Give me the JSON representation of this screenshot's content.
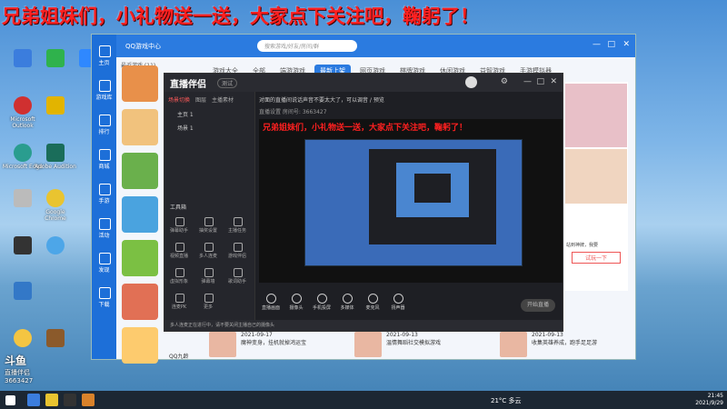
{
  "overlay_text": "兄弟姐妹们，小礼物送一送，大家点下关注吧，鞠躬了！",
  "desktop": {
    "icons": [
      {
        "label": "",
        "color": "#3b7ddd"
      },
      {
        "label": "",
        "color": "#2fb24c"
      },
      {
        "label": "",
        "color": "#2f88ff"
      },
      {
        "label": "",
        "color": "#e2b400"
      },
      {
        "label": "Microsoft Outlook",
        "color": "#d03030"
      },
      {
        "label": "",
        "color": "#f4c542"
      },
      {
        "label": "Microsoft Edge",
        "color": "#2a9d8f"
      },
      {
        "label": "Adobe Audition",
        "color": "#1a6d5a"
      },
      {
        "label": "",
        "color": "#bbbbbb"
      },
      {
        "label": "Google Chrome",
        "color": "#e9c430"
      },
      {
        "label": "",
        "color": "#3378c7"
      },
      {
        "label": "",
        "color": "#333333"
      },
      {
        "label": "",
        "color": "#4da6e8"
      },
      {
        "label": "",
        "color": "#8b5a2b"
      }
    ]
  },
  "qq_window": {
    "title": "QQ游戏中心",
    "search_placeholder": "搜索游戏/好友/房间/群",
    "nav": [
      "主页",
      "游戏库",
      "排行",
      "商城",
      "手游",
      "活动",
      "发现",
      "下载"
    ],
    "tabs": [
      "游戏大全",
      "全部",
      "端游游戏",
      "最新上架",
      "网页游戏",
      "棋牌游戏",
      "休闲游戏",
      "益智游戏",
      "手游模拟器"
    ],
    "active_tab": "最新上架",
    "recent_label": "最近游戏 (11)",
    "friends_label": "QQ九龄",
    "side_labels": [
      "站到神牌，我要",
      "试玩一下"
    ],
    "cards": [
      {
        "date": "2021-09-17",
        "title": "魔神变身，挂机就掉鸿运宝"
      },
      {
        "date": "2021-09-13",
        "title": "温情舞蹈社交模拟游戏"
      },
      {
        "date": "2021-09-13",
        "title": "收集英雄养成，跑手足足游"
      }
    ]
  },
  "stream_window": {
    "title": "直播伴侣",
    "badge": "测试",
    "left_tabs": [
      "场景切换",
      "图层",
      "主播素材"
    ],
    "scenes": [
      "主页 1",
      "场景 1"
    ],
    "tools_title": "工具箱",
    "tools": [
      "弹幕助手",
      "抽奖设置",
      "主播任务",
      "视频直播",
      "多人连麦",
      "游戏伴侣",
      "虚拟形象",
      "弹幕墙",
      "歌词助手",
      "连麦PK",
      "更多"
    ],
    "notice": "对面的直播间说话声音不要太大了，可以调音 / 预览",
    "room_info": "直播设置 房间号: 3663427",
    "preview_text": "兄弟姐妹们，小礼物送一送，大家点下关注吧，鞠躬了！",
    "bottom_buttons": [
      "直播画面",
      "摄像头",
      "手机投屏",
      "多媒体",
      "麦克风",
      "扬声器"
    ],
    "start_label": "开始直播",
    "status": "多人连麦正在进行中，请不要关闭主播自己的摄像头"
  },
  "watermark": {
    "brand": "斗鱼",
    "sub": "直播伴侣",
    "room": "3663427"
  },
  "taskbar": {
    "weather": "21°C 多云",
    "time": "21:45",
    "date": "2021/9/29",
    "icons": [
      {
        "color": "#ffffff"
      },
      {
        "color": "#3b7ddd"
      },
      {
        "color": "#e9c430"
      },
      {
        "color": "#333333"
      },
      {
        "color": "#d9822b"
      }
    ]
  }
}
